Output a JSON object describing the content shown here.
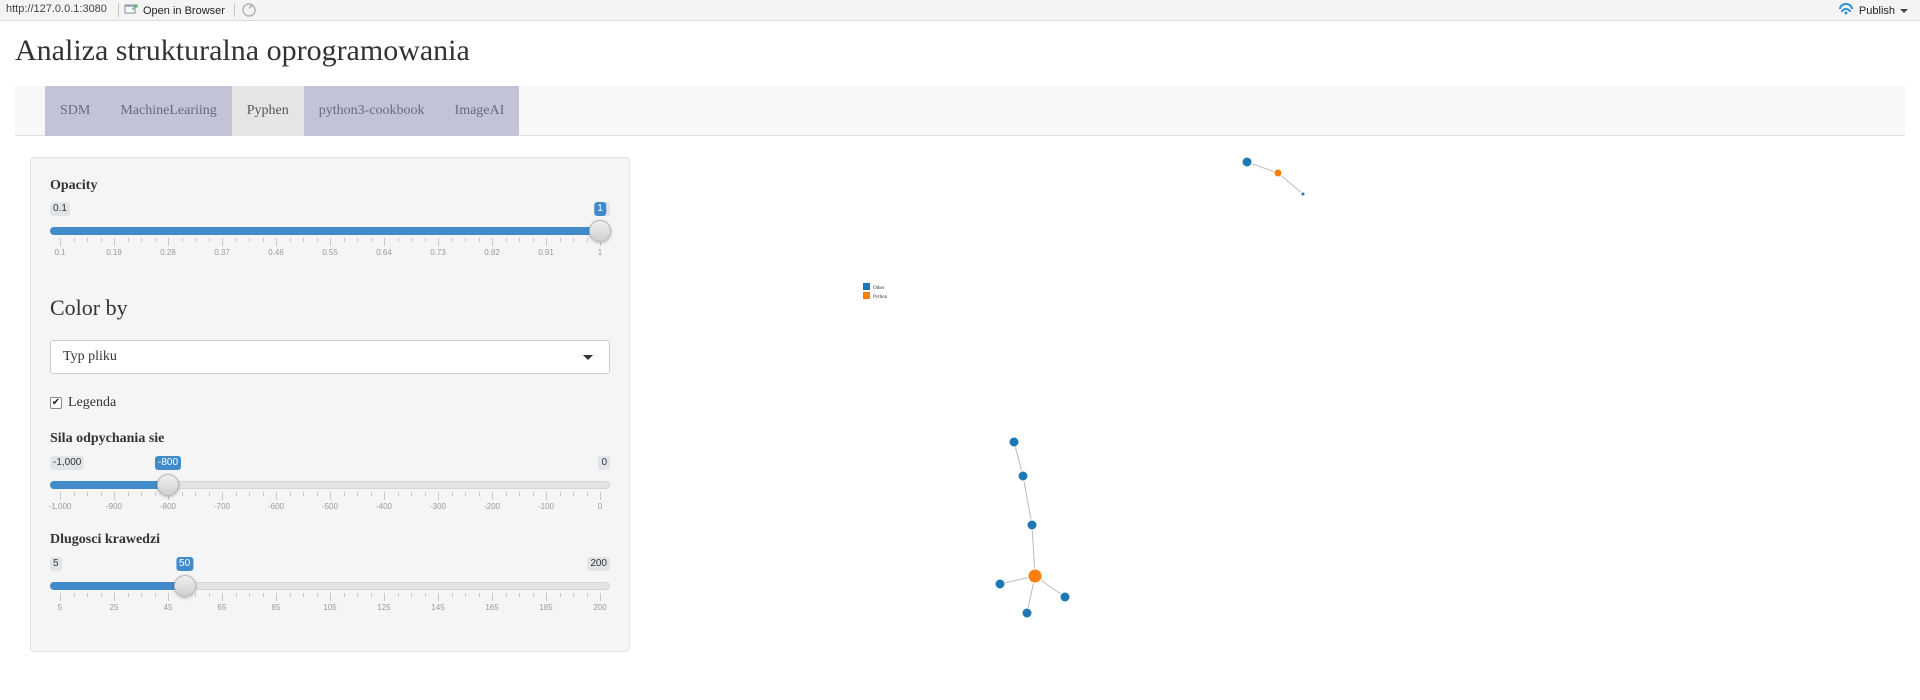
{
  "browser": {
    "url": "http://127.0.0.1:3080",
    "open_in_browser": "Open in Browser",
    "publish": "Publish"
  },
  "app": {
    "title": "Analiza strukturalna oprogramowania",
    "tabs": [
      {
        "label": "SDM",
        "active": false
      },
      {
        "label": "MachineLeariing",
        "active": false
      },
      {
        "label": "Pyphen",
        "active": true
      },
      {
        "label": "python3-cookbook",
        "active": false
      },
      {
        "label": "ImageAI",
        "active": false
      }
    ]
  },
  "sidebar": {
    "opacity": {
      "label": "Opacity",
      "min": "0.1",
      "max": "1",
      "value": "1",
      "min_num": 0.1,
      "max_num": 1,
      "value_num": 1,
      "ticks": [
        "0.1",
        "0.19",
        "0.28",
        "0.37",
        "0.46",
        "0.55",
        "0.64",
        "0.73",
        "0.82",
        "0.91",
        "1"
      ]
    },
    "color_by": {
      "heading": "Color by",
      "selected": "Typ pliku"
    },
    "legend_checkbox": {
      "label": "Legenda",
      "checked": true,
      "mark": "✔"
    },
    "repulsion": {
      "label": "Sila odpychania sie",
      "min": "-1,000",
      "max": "0",
      "value": "-800",
      "min_num": -1000,
      "max_num": 0,
      "value_num": -800,
      "ticks": [
        "-1,000",
        "-900",
        "-800",
        "-700",
        "-600",
        "-500",
        "-400",
        "-300",
        "-200",
        "-100",
        "0"
      ]
    },
    "edge_length": {
      "label": "Dlugosci krawedzi",
      "min": "5",
      "max": "200",
      "value": "50",
      "min_num": 5,
      "max_num": 200,
      "value_num": 50,
      "ticks": [
        "5",
        "25",
        "45",
        "65",
        "85",
        "105",
        "125",
        "145",
        "165",
        "185",
        "200"
      ]
    }
  },
  "graph": {
    "legend": [
      {
        "label": "Other",
        "color": "#1f77b4"
      },
      {
        "label": "Python",
        "color": "#ff7f0e"
      }
    ],
    "colors": {
      "other": "#1f77b4",
      "python": "#ff7f0e",
      "edge": "#bbbbbb"
    }
  }
}
